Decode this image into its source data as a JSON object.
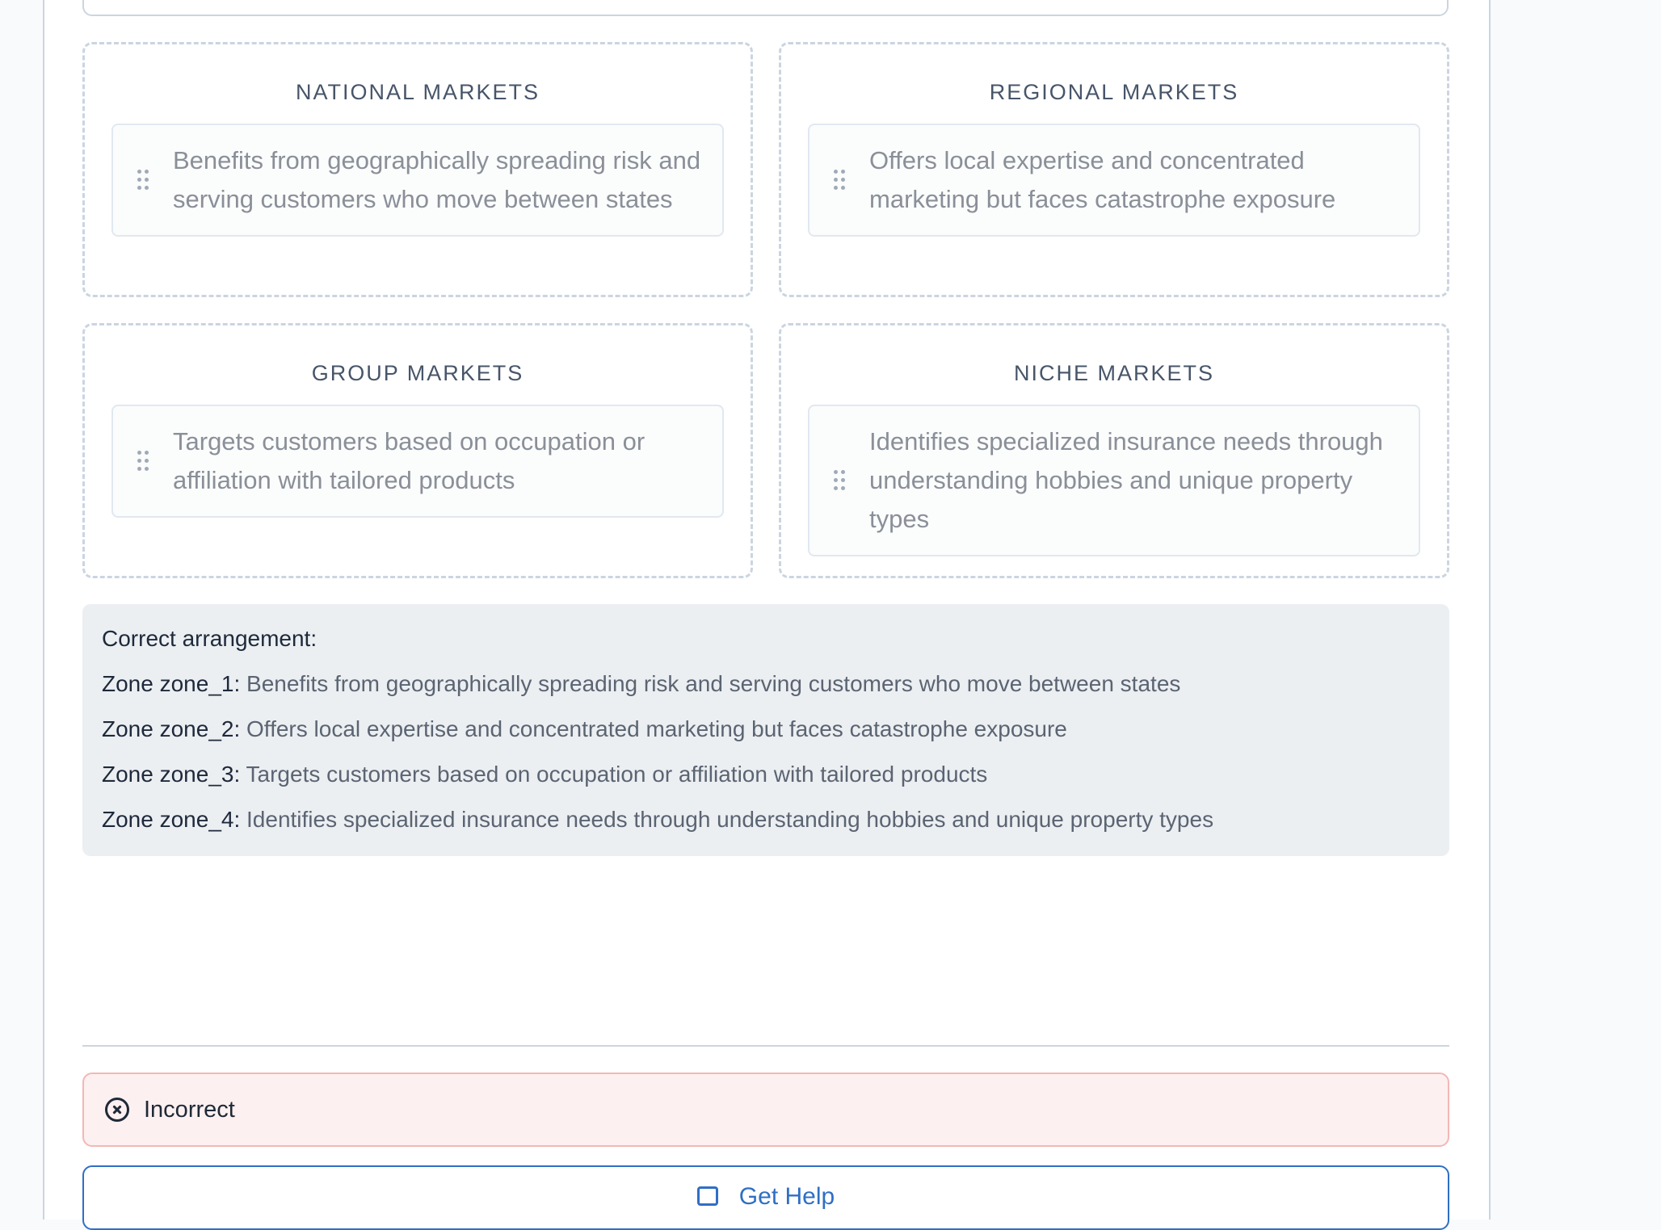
{
  "zones": [
    {
      "title": "NATIONAL MARKETS",
      "item": "Benefits from geographically spreading risk and serving customers who move between states"
    },
    {
      "title": "REGIONAL MARKETS",
      "item": "Offers local expertise and concentrated marketing but faces catastrophe exposure"
    },
    {
      "title": "GROUP MARKETS",
      "item": "Targets customers based on occupation or affiliation with tailored products"
    },
    {
      "title": "NICHE MARKETS",
      "item": "Identifies specialized insurance needs through understanding hobbies and unique property types"
    }
  ],
  "answer": {
    "heading": "Correct arrangement:",
    "lines": [
      {
        "label": "Zone zone_1:",
        "value": "Benefits from geographically spreading risk and serving customers who move between states"
      },
      {
        "label": "Zone zone_2:",
        "value": "Offers local expertise and concentrated marketing but faces catastrophe exposure"
      },
      {
        "label": "Zone zone_3:",
        "value": "Targets customers based on occupation or affiliation with tailored products"
      },
      {
        "label": "Zone zone_4:",
        "value": "Identifies specialized insurance needs through understanding hobbies and unique property types"
      }
    ]
  },
  "result": {
    "text": "Incorrect",
    "icon": "x-circle-icon",
    "status_color": "#f3b7b7"
  },
  "help_button": {
    "label": "Get Help",
    "icon": "chat-icon",
    "accent_color": "#2f6fc4"
  }
}
